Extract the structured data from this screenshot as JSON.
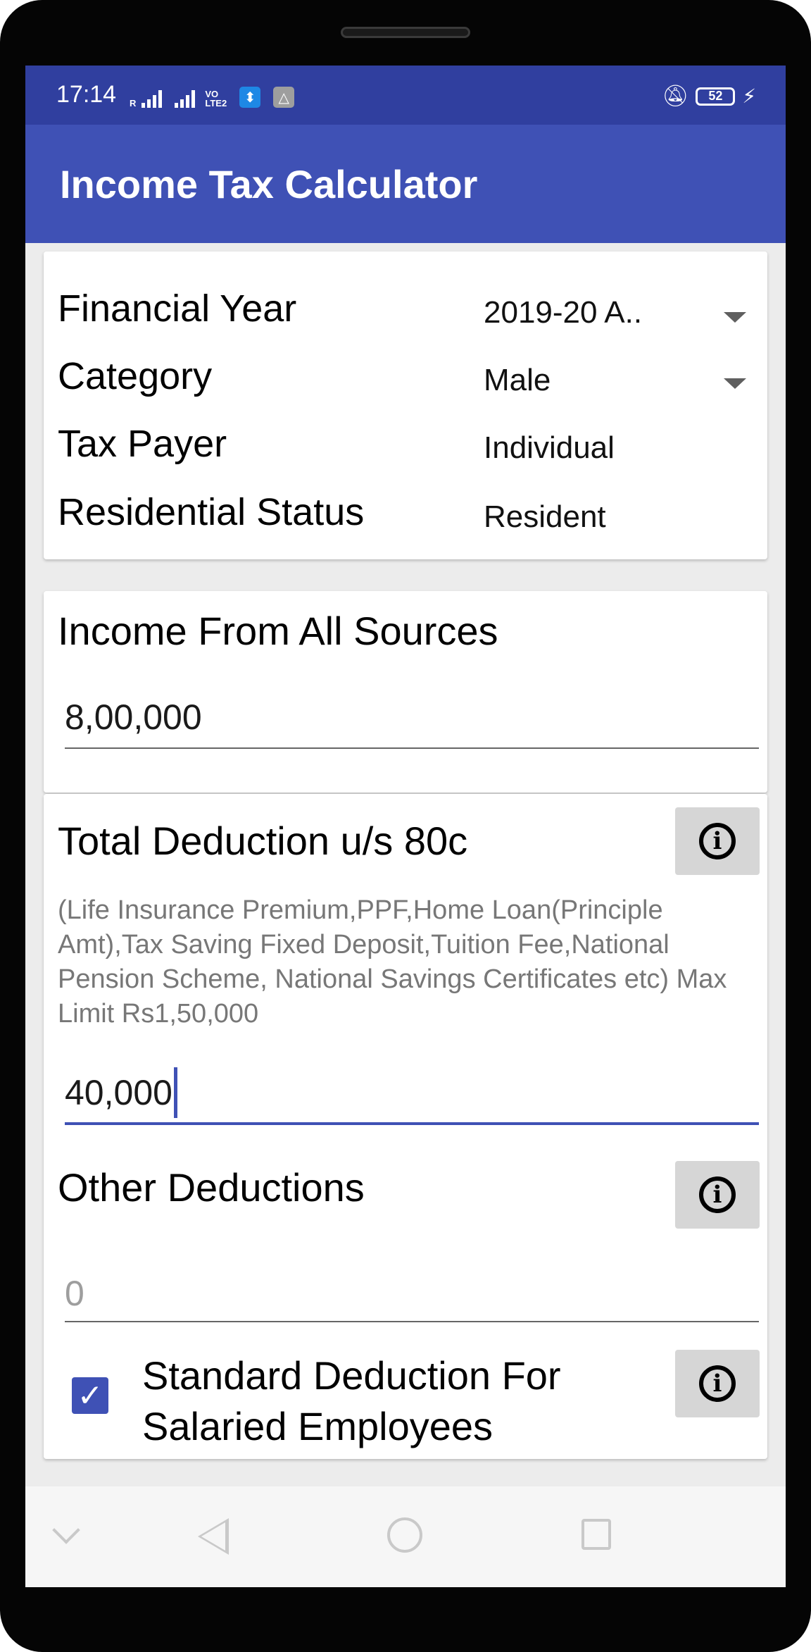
{
  "status_bar": {
    "time": "17:14",
    "network_small": "R",
    "volte_label": "VO\nLTE2",
    "battery": "52"
  },
  "app_bar": {
    "title": "Income Tax Calculator"
  },
  "settings_card": {
    "financial_year": {
      "label": "Financial Year",
      "value": "2019-20 A.."
    },
    "category": {
      "label": "Category",
      "value": "Male"
    },
    "tax_payer": {
      "label": "Tax Payer",
      "value": "Individual"
    },
    "residential_status": {
      "label": "Residential Status",
      "value": "Resident"
    }
  },
  "income_card": {
    "title": "Income From All Sources",
    "value": "8,00,000"
  },
  "deductions_card": {
    "section_80c": {
      "title": "Total Deduction u/s 80c",
      "help": "(Life Insurance Premium,PPF,Home Loan(Principle Amt),Tax Saving Fixed Deposit,Tuition Fee,National Pension Scheme, National Savings Certificates etc) Max Limit Rs1,50,000",
      "value": "40,000"
    },
    "other": {
      "title": "Other Deductions",
      "placeholder": "0"
    },
    "standard_deduction": {
      "label": "Standard Deduction For Salaried Employees",
      "checked": true
    }
  },
  "colors": {
    "status_bar": "#303f9f",
    "app_bar": "#3f51b5",
    "accent": "#3f51b5"
  }
}
